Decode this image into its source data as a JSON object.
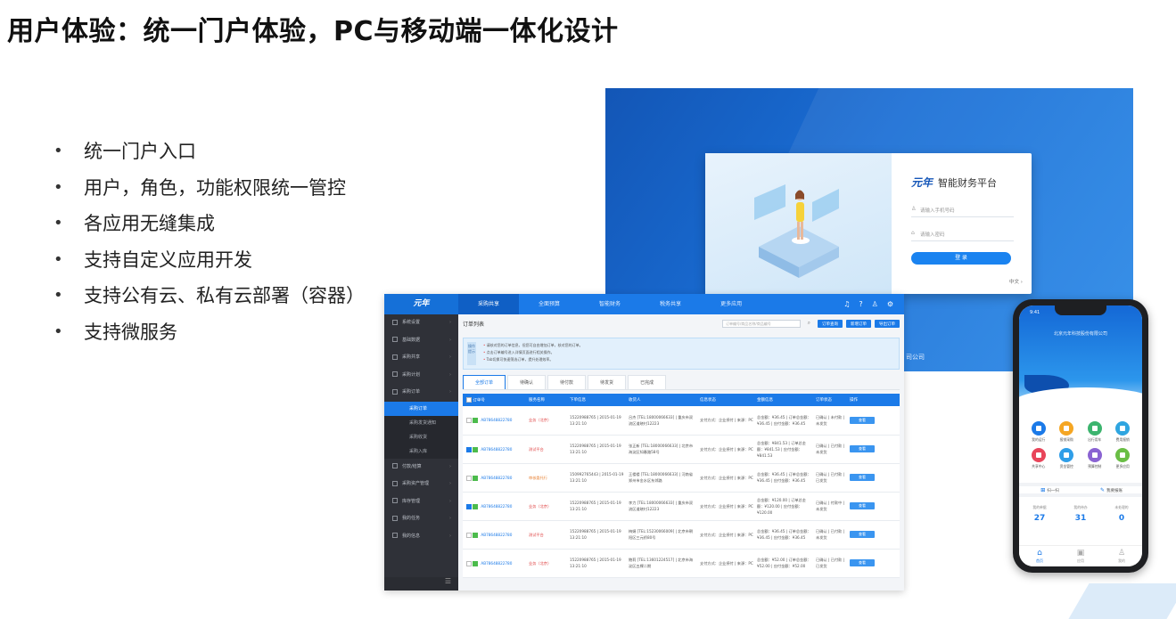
{
  "slide": {
    "title": "用户体验：统一门户体验，PC与移动端一体化设计",
    "bullets": [
      "统一门户入口",
      "用户，角色，功能权限统一管控",
      "各应用无缝集成",
      "支持自定义应用开发",
      "支持公有云、私有云部署（容器）",
      "支持微服务"
    ]
  },
  "login": {
    "logo": "元年",
    "title": "智能财务平台",
    "username_placeholder": "请输入手机号码",
    "password_placeholder": "请输入密码",
    "login_button": "登 录",
    "language": "中文",
    "footer_text": "司公司"
  },
  "admin": {
    "logo": "元年",
    "nav": [
      "采购共享",
      "全面预算",
      "智能财务",
      "税务共享",
      "更多应用"
    ],
    "sidebar": {
      "items_top": [
        "系统设置",
        "基础数据",
        "采购共享",
        "采购计划",
        "采购订单"
      ],
      "sub_items": [
        "采购订单",
        "采购发货通知",
        "采购收货",
        "采购入库"
      ],
      "items_bottom": [
        "付款/结算",
        "采购资产管理",
        "库存管理",
        "我的任务",
        "我的信息"
      ]
    },
    "page_title": "订单列表",
    "search_placeholder": "订单编号/商品名称/商品编号",
    "buttons": [
      "订单查询",
      "新增订单",
      "导出订单"
    ],
    "note_label": "操作提示",
    "notes": [
      "请核对您的订单信息，但您可自由增加订单，核对您的订单。",
      "点击订单编号进入详情页面进行相关操作。",
      "Tab切换可快速筛选订单，提升处理效率。"
    ],
    "tabs": [
      "全部订单",
      "待确认",
      "待付款",
      "待发货",
      "已完成"
    ],
    "table": {
      "headers": [
        "订单号",
        "服务名称",
        "下单信息",
        "收货人",
        "信息状态",
        "金额信息",
        "订单状态",
        "操作"
      ],
      "rows": [
        {
          "checked": false,
          "order": "AB78648822780",
          "service": "业务（北京）",
          "service_color": "red",
          "time": "15220988765 | 2015-01-19 13:21:10",
          "receiver": "吕杰 [TEL:18000066633] | 重庆市双流区道晓村12223",
          "info": "支付方式：企业授付 | 来源：PC",
          "amount": "总金额：¥36.45 | 订单总金额：¥36.45 | 应付金额：¥36.45",
          "status": "已确认 | 未付款 | 未发货",
          "op": "查看"
        },
        {
          "checked": true,
          "order": "AB78648822780",
          "service": "测试平台",
          "service_color": "red",
          "time": "15220988765 | 2015-01-19 13:21:10",
          "receiver": "张正新 [TEL:18000066633] | 北京市海淀区知春路58号",
          "info": "支付方式：企业授付 | 来源：PC",
          "amount": "总金额：¥841.53 | 订单总金额：¥841.53 | 应付金额：¥841.53",
          "status": "已确认 | 已付款 | 未发货",
          "op": "查看"
        },
        {
          "checked": false,
          "order": "AB78648822780",
          "service": "审核委托行",
          "service_color": "orange",
          "time": "150992765443 | 2015-01-19 13:21:10",
          "receiver": "王楼楼 [TEL:18000066633] | 河南省郑州市金水区东郊路",
          "info": "支付方式：企业授付 | 来源：PC",
          "amount": "总金额：¥36.45 | 订单总金额：¥36.45 | 应付金额：¥36.45",
          "status": "已确认 | 已付款 | 已发货",
          "op": "查看"
        },
        {
          "checked": true,
          "order": "AB78648822780",
          "service": "业务（北京）",
          "service_color": "red",
          "time": "15220988765 | 2015-01-19 13:21:10",
          "receiver": "李力 [TEL:18000066633] | 重庆市双流区道晓村12223",
          "info": "支付方式：企业授付 | 来源：PC",
          "amount": "总金额：¥120.00 | 订单总金额：¥120.00 | 应付金额：¥120.00",
          "status": "已确认 | 付款中 | 未发货",
          "op": "查看"
        },
        {
          "checked": false,
          "order": "AB78648822780",
          "service": "测试平台",
          "service_color": "red",
          "time": "15220988765 | 2015-01-19 13:21:10",
          "receiver": "梅娟 [TEL:15230066009] | 北京市朝阳区三元桥80号",
          "info": "支付方式：企业授付 | 来源：PC",
          "amount": "总金额：¥36.45 | 订单总金额：¥36.45 | 应付金额：¥36.45",
          "status": "已确认 | 已付款 | 未发货",
          "op": "查看"
        },
        {
          "checked": false,
          "order": "AB78648822780",
          "service": "业务（北京）",
          "service_color": "red",
          "time": "15220988765 | 2015-01-19 13:21:10",
          "receiver": "鲍莉 [TEL:13601224517] | 北京市海淀区五棵二期",
          "info": "支付方式：企业授付 | 来源：PC",
          "amount": "总金额：¥52.00 | 订单总金额：¥52.00 | 应付金额：¥52.00",
          "status": "已确认 | 已付款 | 已发货",
          "op": "查看"
        }
      ]
    }
  },
  "phone": {
    "status_time": "9:41",
    "title": "北京元年科技股份有限公司",
    "apps": [
      {
        "label": "我的运行",
        "color": "#1b7ae8"
      },
      {
        "label": "报销采购",
        "color": "#f5a623"
      },
      {
        "label": "出行用车",
        "color": "#3cb46e"
      },
      {
        "label": "费用报销",
        "color": "#2fa5e0"
      },
      {
        "label": "共享中心",
        "color": "#e8455a"
      },
      {
        "label": "资金管控",
        "color": "#2f9ee8"
      },
      {
        "label": "预算控制",
        "color": "#8a63d2"
      },
      {
        "label": "更多应用",
        "color": "#6abe45"
      }
    ],
    "quick": [
      {
        "icon": "⊞",
        "label": "扫一扫"
      },
      {
        "icon": "✎",
        "label": "我要报账"
      }
    ],
    "stats": [
      {
        "label": "我的单据",
        "value": "27"
      },
      {
        "label": "我的待办",
        "value": "31"
      },
      {
        "label": "未处理的",
        "value": "0"
      }
    ],
    "tabs": [
      "首页",
      "应用",
      "我的"
    ]
  }
}
